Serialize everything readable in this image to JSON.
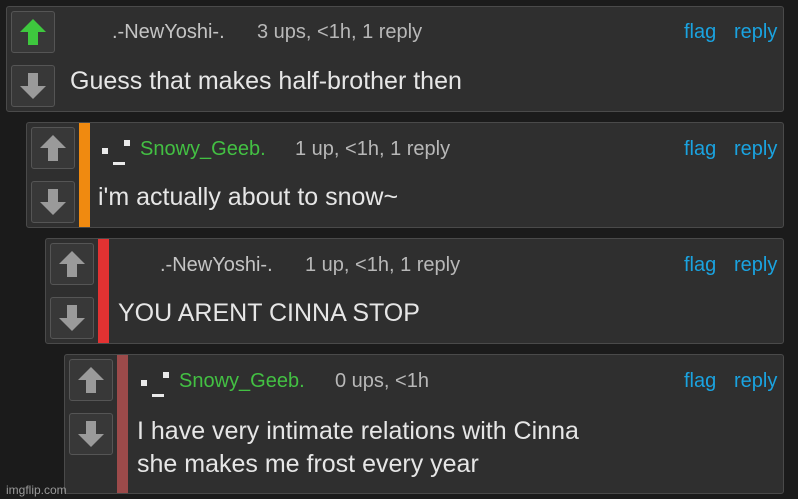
{
  "colors": {
    "background": "#1b1b1b",
    "card": "#2f2f2f",
    "upvoted_arrow": "#3ec83e",
    "neutral_arrow": "#9a9a9a",
    "link": "#1aa3e0",
    "username_green": "#43c043",
    "bar_orange": "#f08a10",
    "bar_red": "#e23232",
    "bar_dim_red": "#9c4a4a"
  },
  "comments": [
    {
      "username": ".-NewYoshi-.",
      "meta": "3 ups, <1h, 1 reply",
      "flag": "flag",
      "reply": "reply",
      "lines": [
        "Guess that makes half-brother then"
      ],
      "upvoted": true
    },
    {
      "username": "Snowy_Geeb.",
      "meta": "1 up, <1h, 1 reply",
      "flag": "flag",
      "reply": "reply",
      "lines": [
        "i'm actually about to snow~"
      ],
      "upvoted": false
    },
    {
      "username": ".-NewYoshi-.",
      "meta": "1 up, <1h, 1 reply",
      "flag": "flag",
      "reply": "reply",
      "lines": [
        "YOU ARENT CINNA STOP"
      ],
      "upvoted": false
    },
    {
      "username": "Snowy_Geeb.",
      "meta": "0 ups, <1h",
      "flag": "flag",
      "reply": "reply",
      "lines": [
        "I have very intimate relations with Cinna",
        "she makes me frost every year"
      ],
      "upvoted": false
    }
  ],
  "watermark": "imgflip.com"
}
